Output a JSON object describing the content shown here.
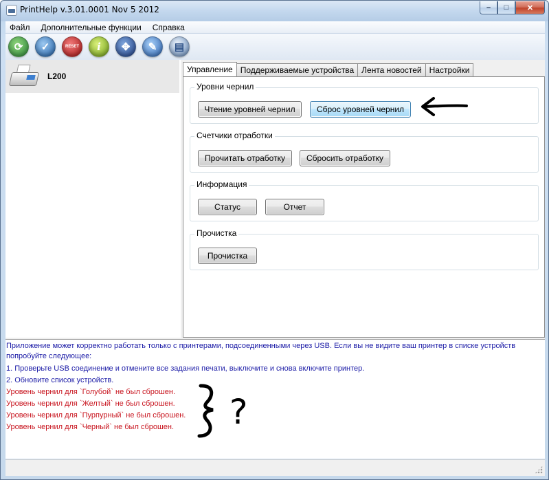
{
  "window": {
    "title": "PrintHelp v.3.01.0001 Nov  5 2012",
    "controls": {
      "minimize": "–",
      "maximize": "□",
      "close": "✕"
    }
  },
  "menu": [
    "Файл",
    "Дополнительные функции",
    "Справка"
  ],
  "toolbar": {
    "icons": [
      "refresh-icon",
      "check-icon",
      "reset-icon",
      "info-icon",
      "network-icon",
      "tools-icon",
      "book-icon"
    ],
    "reset_label": "RESET",
    "info_glyph": "i"
  },
  "devices": [
    {
      "name": "L200",
      "icon": "printer-icon"
    }
  ],
  "tabs": [
    "Управление",
    "Поддерживаемые устройства",
    "Лента новостей",
    "Настройки"
  ],
  "active_tab": "Управление",
  "groups": {
    "ink_levels": {
      "title": "Уровни чернил",
      "read_button": "Чтение уровней чернил",
      "reset_button": "Сброс уровней чернил"
    },
    "waste_counters": {
      "title": "Счетчики отработки",
      "read_button": "Прочитать отработку",
      "reset_button": "Сбросить отработку"
    },
    "information": {
      "title": "Информация",
      "status_button": "Статус",
      "report_button": "Отчет"
    },
    "cleaning": {
      "title": "Прочистка",
      "clean_button": "Прочистка"
    }
  },
  "log": {
    "intro": "Приложение может корректно работать только с принтерами, подсоединенными через USB. Если вы не видите ваш принтер в списке устройств попробуйте следующее:",
    "step1": "1. Проверьте USB соединение и отмените все задания печати, выключите и снова включите принтер.",
    "step2": "2. Обновите список устройств.",
    "errors": [
      "Уровень чернил для `Голубой` не был сброшен.",
      "Уровень чернил для `Желтый` не был сброшен.",
      "Уровень чернил для `Пурпурный` не был сброшен.",
      "Уровень чернил для `Черный` не был сброшен."
    ]
  },
  "annotations": {
    "question_mark": "?"
  },
  "colors": {
    "log_info": "#1a1aa6",
    "log_error": "#c8141e",
    "hover_button": "#bee6fd"
  }
}
